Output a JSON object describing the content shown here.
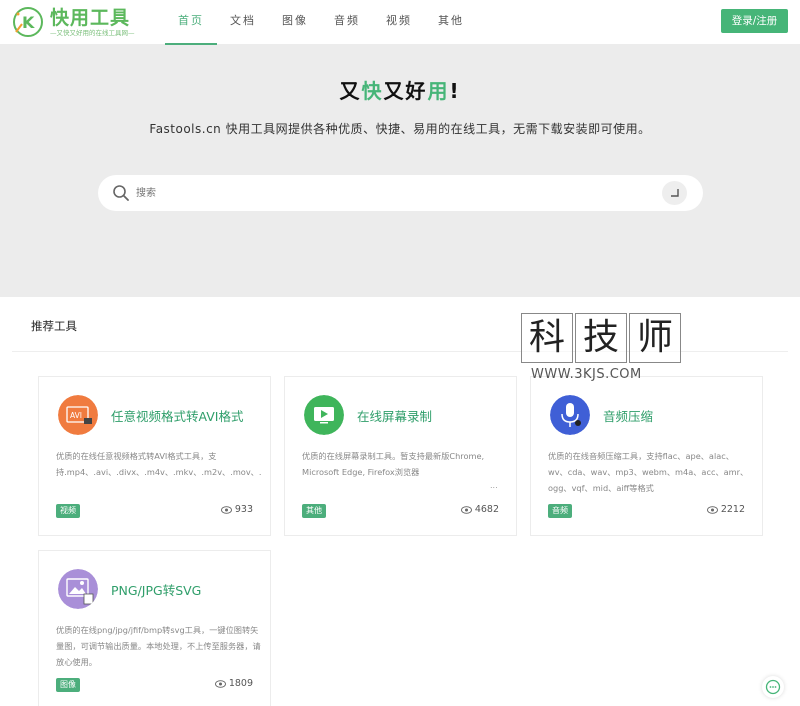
{
  "header": {
    "logo_title": "快用工具",
    "logo_sub": "—又快又好用的在线工具网—",
    "nav": [
      {
        "label": "首页",
        "active": true
      },
      {
        "label": "文档",
        "active": false
      },
      {
        "label": "图像",
        "active": false
      },
      {
        "label": "音频",
        "active": false
      },
      {
        "label": "视频",
        "active": false
      },
      {
        "label": "其他",
        "active": false
      }
    ],
    "login_label": "登录/注册"
  },
  "hero": {
    "title_parts": [
      "又",
      "快",
      "又好",
      "用",
      "!"
    ],
    "subtitle": "Fastools.cn 快用工具网提供各种优质、快捷、易用的在线工具，无需下载安装即可使用。",
    "search_placeholder": "搜索"
  },
  "recommend": {
    "title": "推荐工具",
    "cards": [
      {
        "title": "任意视频格式转AVI格式",
        "desc": "优质的在线任意视频格式转AVI格式工具，支持.mp4、.avi、.divx、.m4v、.mkv、.m2v、.mov、.mpeg、.mpg、.ogm、.ogv、.ogx、.rm、",
        "tag": "视频",
        "views": "933",
        "icon": "avi-file-icon",
        "icon_color": "#f07b3f"
      },
      {
        "title": "在线屏幕录制",
        "desc": "优质的在线屏幕录制工具。暂支持最新版Chrome, Microsoft Edge, Firefox浏览器",
        "tag": "其他",
        "views": "4682",
        "icon": "screen-record-icon",
        "icon_color": "#3fb55b",
        "ellipsis": "..."
      },
      {
        "title": "音频压缩",
        "desc": "优质的在线音频压缩工具，支持flac、ape、alac、wv、cda、wav、mp3、webm、m4a、acc、amr、ogg、vqf、mid、aiff等格式",
        "tag": "音频",
        "views": "2212",
        "icon": "microphone-icon",
        "icon_color": "#3f5fd6"
      },
      {
        "title": "PNG/JPG转SVG",
        "desc": "优质的在线png/jpg/jfif/bmp转svg工具，一键位图转矢量图，可调节输出质量。本地处理，不上传至服务器，请放心使用。",
        "tag": "图像",
        "views": "1809",
        "icon": "image-file-icon",
        "icon_color": "#a98fd8"
      }
    ]
  },
  "watermark": {
    "chars": [
      "科",
      "技",
      "师"
    ],
    "url": "WWW.3KJS.COM"
  },
  "colors": {
    "accent": "#46b578",
    "hero_bg": "#ececec"
  }
}
